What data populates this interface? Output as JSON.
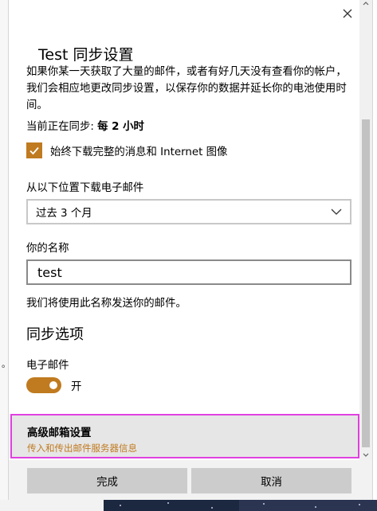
{
  "dialog": {
    "title": "Test 同步设置",
    "description": "如果你某一天获取了大量的邮件，或者有好几天没有查看你的帐户，我们会相应地更改同步设置，以保存你的数据并延长你的电池使用时间。",
    "sync_status_prefix": "当前正在同步:",
    "sync_status_value": "每 2 小时",
    "download_full_label": "始终下载完整的消息和 Internet 图像",
    "download_full_checked": true,
    "download_from_label": "从以下位置下载电子邮件",
    "download_from_value": "过去 3 个月",
    "name_label": "你的名称",
    "name_value": "test",
    "name_hint": "我们将使用此名称发送你的邮件。",
    "sync_options_heading": "同步选项",
    "email_label": "电子邮件",
    "email_toggle_on": true,
    "email_toggle_label": "开",
    "advanced_title": "高级邮箱设置",
    "advanced_subtitle": "传入和传出邮件服务器信息",
    "done_label": "完成",
    "cancel_label": "取消"
  },
  "background": {
    "left_fragment": "。"
  },
  "colors": {
    "accent": "#c07a1f",
    "highlight_border": "#e040e0",
    "button_bg": "#cccccc"
  }
}
